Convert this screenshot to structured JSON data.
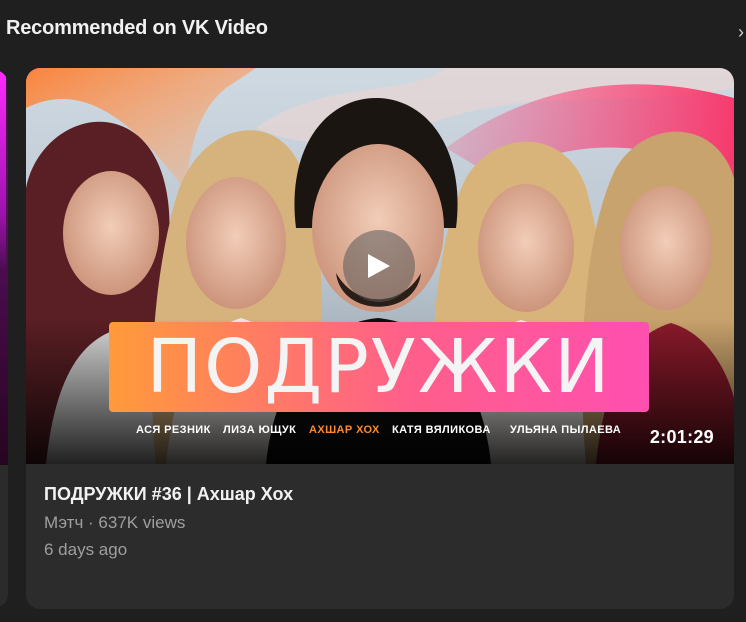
{
  "section": {
    "title": "Recommended on VK Video",
    "next_icon": "chevron-right-icon"
  },
  "video": {
    "thumbnail_logo": "ПОДРУЖКИ",
    "thumbnail_names": [
      "АСЯ РЕЗНИК",
      "ЛИЗА ЮЩУК",
      "АХШАР ХОХ",
      "КАТЯ ВЯЛИКОВА",
      "УЛЬЯНА ПЫЛАЕВА"
    ],
    "highlight_name": "АХШАР ХОХ",
    "duration": "2:01:29",
    "title": "ПОДРУЖКИ #36 | Ахшар Хох",
    "channel": "Мэтч",
    "separator": " · ",
    "views": "637K views",
    "age": "6 days ago",
    "play_icon": "play-icon"
  },
  "colors": {
    "background": "#1f1f1f",
    "card": "#2c2c2c",
    "meta_text": "#9f9f9f",
    "accent_orange": "#ff8a2b",
    "accent_pink": "#ff4fb0"
  }
}
